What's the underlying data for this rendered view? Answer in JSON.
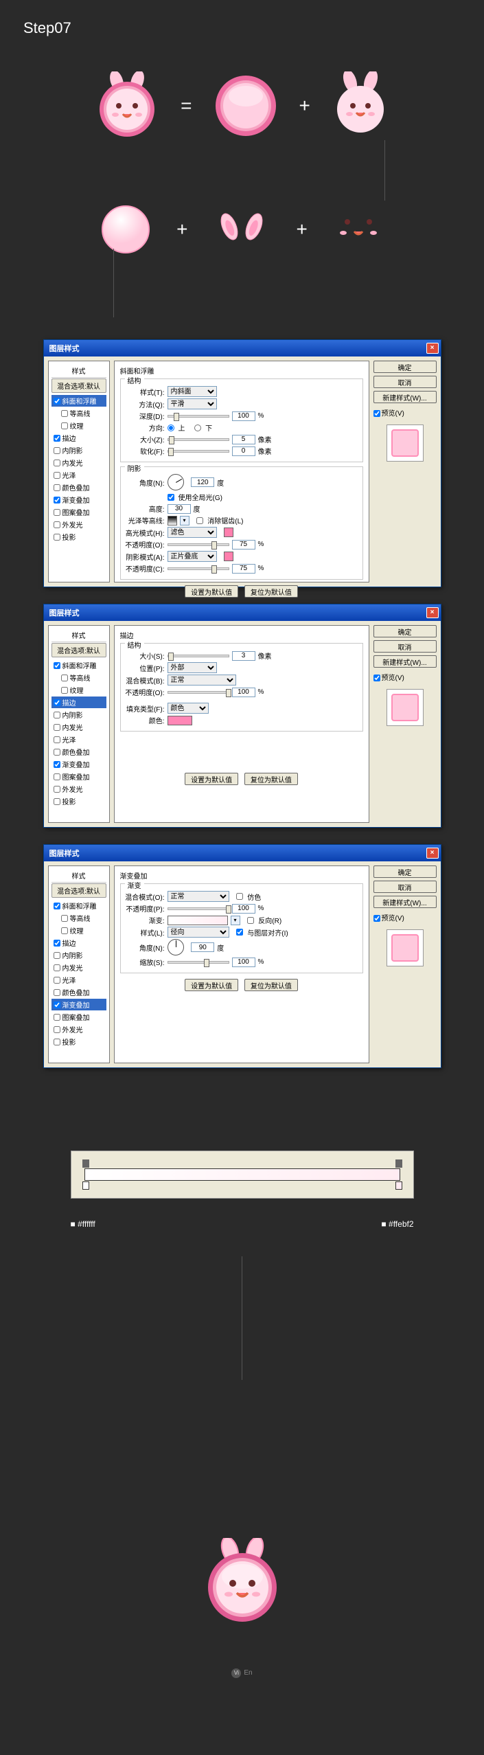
{
  "page": {
    "title": "Step07"
  },
  "illus": {
    "plus": "+",
    "equals": "="
  },
  "colors": {
    "white": "#ffffff",
    "blush": "#ffebf2"
  },
  "dlg": {
    "title": "图层样式",
    "close_x": "×",
    "left": {
      "head_styles": "样式",
      "blend_options": "混合选项:默认",
      "items": [
        {
          "label": "斜面和浮雕",
          "checked": true
        },
        {
          "label": "等高线",
          "checked": false,
          "indent": true
        },
        {
          "label": "纹理",
          "checked": false,
          "indent": true
        },
        {
          "label": "描边",
          "checked": true
        },
        {
          "label": "内阴影",
          "checked": false
        },
        {
          "label": "内发光",
          "checked": false
        },
        {
          "label": "光泽",
          "checked": false
        },
        {
          "label": "颜色叠加",
          "checked": false
        },
        {
          "label": "渐变叠加",
          "checked": true
        },
        {
          "label": "图案叠加",
          "checked": false
        },
        {
          "label": "外发光",
          "checked": false
        },
        {
          "label": "投影",
          "checked": false
        }
      ]
    },
    "right": {
      "ok": "确定",
      "cancel": "取消",
      "new_style": "新建样式(W)...",
      "preview": "预览(V)"
    },
    "common_btns": {
      "default": "设置为默认值",
      "reset": "复位为默认值"
    },
    "panel1": {
      "title": "斜面和浮雕",
      "structure": "结构",
      "style_lbl": "样式(T):",
      "style_val": "内斜面",
      "method_lbl": "方法(Q):",
      "method_val": "平滑",
      "depth_lbl": "深度(D):",
      "depth_val": "100",
      "pct": "%",
      "direction_lbl": "方向:",
      "up": "上",
      "down": "下",
      "size_lbl": "大小(Z):",
      "size_val": "5",
      "px": "像素",
      "soften_lbl": "软化(F):",
      "soften_val": "0",
      "shadow": "阴影",
      "angle_lbl": "角度(N):",
      "angle_val": "120",
      "deg": "度",
      "global": "使用全局光(G)",
      "altitude_lbl": "高度:",
      "altitude_val": "30",
      "gloss_lbl": "光泽等高线:",
      "antialias": "消除锯齿(L)",
      "hlmode_lbl": "高光模式(H):",
      "hl_val": "滤色",
      "hl_opacity": "不透明度(O):",
      "hl_op_val": "75",
      "shmode_lbl": "阴影模式(A):",
      "sh_val": "正片叠底",
      "sh_opacity": "不透明度(C):",
      "sh_op_val": "75"
    },
    "panel2": {
      "title": "描边",
      "structure": "结构",
      "size_lbl": "大小(S):",
      "size_val": "3",
      "px": "像素",
      "pos_lbl": "位置(P):",
      "pos_val": "外部",
      "blend_lbl": "混合模式(B):",
      "blend_val": "正常",
      "opacity_lbl": "不透明度(O):",
      "opacity_val": "100",
      "pct": "%",
      "filltype_lbl": "填充类型(F):",
      "filltype_val": "颜色",
      "color_lbl": "颜色:",
      "color": "#ff87b6"
    },
    "panel3": {
      "title": "渐变叠加",
      "section": "渐变",
      "blend_lbl": "混合模式(O):",
      "blend_val": "正常",
      "dither": "仿色",
      "opacity_lbl": "不透明度(P):",
      "opacity_val": "100",
      "pct": "%",
      "grad_lbl": "渐变:",
      "reverse": "反向(R)",
      "style_lbl": "样式(L):",
      "style_val": "径向",
      "align": "与图层对齐(I)",
      "angle_lbl": "角度(N):",
      "angle_val": "90",
      "deg": "度",
      "scale_lbl": "缩放(S):",
      "scale_val": "100"
    }
  },
  "badge": {
    "v": "Vi",
    "brand": "En"
  }
}
